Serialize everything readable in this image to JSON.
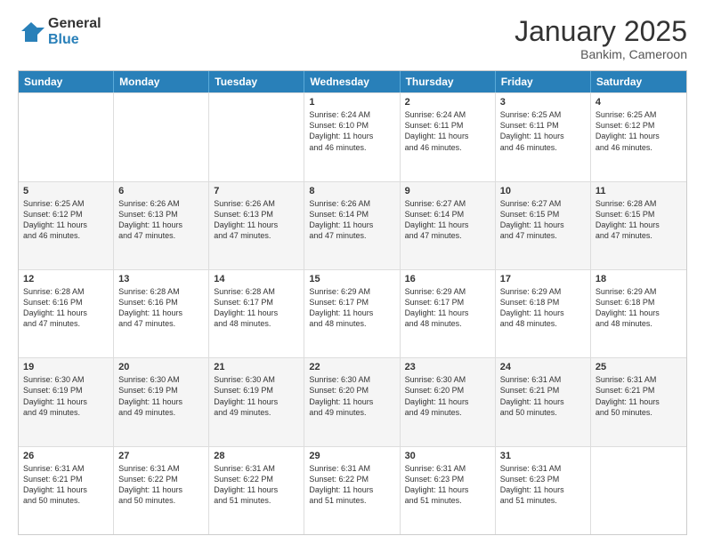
{
  "header": {
    "logo_general": "General",
    "logo_blue": "Blue",
    "month_title": "January 2025",
    "location": "Bankim, Cameroon"
  },
  "days_of_week": [
    "Sunday",
    "Monday",
    "Tuesday",
    "Wednesday",
    "Thursday",
    "Friday",
    "Saturday"
  ],
  "weeks": [
    [
      {
        "num": "",
        "lines": [],
        "empty": true
      },
      {
        "num": "",
        "lines": [],
        "empty": true
      },
      {
        "num": "",
        "lines": [],
        "empty": true
      },
      {
        "num": "1",
        "lines": [
          "Sunrise: 6:24 AM",
          "Sunset: 6:10 PM",
          "Daylight: 11 hours",
          "and 46 minutes."
        ]
      },
      {
        "num": "2",
        "lines": [
          "Sunrise: 6:24 AM",
          "Sunset: 6:11 PM",
          "Daylight: 11 hours",
          "and 46 minutes."
        ]
      },
      {
        "num": "3",
        "lines": [
          "Sunrise: 6:25 AM",
          "Sunset: 6:11 PM",
          "Daylight: 11 hours",
          "and 46 minutes."
        ]
      },
      {
        "num": "4",
        "lines": [
          "Sunrise: 6:25 AM",
          "Sunset: 6:12 PM",
          "Daylight: 11 hours",
          "and 46 minutes."
        ]
      }
    ],
    [
      {
        "num": "5",
        "lines": [
          "Sunrise: 6:25 AM",
          "Sunset: 6:12 PM",
          "Daylight: 11 hours",
          "and 46 minutes."
        ]
      },
      {
        "num": "6",
        "lines": [
          "Sunrise: 6:26 AM",
          "Sunset: 6:13 PM",
          "Daylight: 11 hours",
          "and 47 minutes."
        ]
      },
      {
        "num": "7",
        "lines": [
          "Sunrise: 6:26 AM",
          "Sunset: 6:13 PM",
          "Daylight: 11 hours",
          "and 47 minutes."
        ]
      },
      {
        "num": "8",
        "lines": [
          "Sunrise: 6:26 AM",
          "Sunset: 6:14 PM",
          "Daylight: 11 hours",
          "and 47 minutes."
        ]
      },
      {
        "num": "9",
        "lines": [
          "Sunrise: 6:27 AM",
          "Sunset: 6:14 PM",
          "Daylight: 11 hours",
          "and 47 minutes."
        ]
      },
      {
        "num": "10",
        "lines": [
          "Sunrise: 6:27 AM",
          "Sunset: 6:15 PM",
          "Daylight: 11 hours",
          "and 47 minutes."
        ]
      },
      {
        "num": "11",
        "lines": [
          "Sunrise: 6:28 AM",
          "Sunset: 6:15 PM",
          "Daylight: 11 hours",
          "and 47 minutes."
        ]
      }
    ],
    [
      {
        "num": "12",
        "lines": [
          "Sunrise: 6:28 AM",
          "Sunset: 6:16 PM",
          "Daylight: 11 hours",
          "and 47 minutes."
        ]
      },
      {
        "num": "13",
        "lines": [
          "Sunrise: 6:28 AM",
          "Sunset: 6:16 PM",
          "Daylight: 11 hours",
          "and 47 minutes."
        ]
      },
      {
        "num": "14",
        "lines": [
          "Sunrise: 6:28 AM",
          "Sunset: 6:17 PM",
          "Daylight: 11 hours",
          "and 48 minutes."
        ]
      },
      {
        "num": "15",
        "lines": [
          "Sunrise: 6:29 AM",
          "Sunset: 6:17 PM",
          "Daylight: 11 hours",
          "and 48 minutes."
        ]
      },
      {
        "num": "16",
        "lines": [
          "Sunrise: 6:29 AM",
          "Sunset: 6:17 PM",
          "Daylight: 11 hours",
          "and 48 minutes."
        ]
      },
      {
        "num": "17",
        "lines": [
          "Sunrise: 6:29 AM",
          "Sunset: 6:18 PM",
          "Daylight: 11 hours",
          "and 48 minutes."
        ]
      },
      {
        "num": "18",
        "lines": [
          "Sunrise: 6:29 AM",
          "Sunset: 6:18 PM",
          "Daylight: 11 hours",
          "and 48 minutes."
        ]
      }
    ],
    [
      {
        "num": "19",
        "lines": [
          "Sunrise: 6:30 AM",
          "Sunset: 6:19 PM",
          "Daylight: 11 hours",
          "and 49 minutes."
        ]
      },
      {
        "num": "20",
        "lines": [
          "Sunrise: 6:30 AM",
          "Sunset: 6:19 PM",
          "Daylight: 11 hours",
          "and 49 minutes."
        ]
      },
      {
        "num": "21",
        "lines": [
          "Sunrise: 6:30 AM",
          "Sunset: 6:19 PM",
          "Daylight: 11 hours",
          "and 49 minutes."
        ]
      },
      {
        "num": "22",
        "lines": [
          "Sunrise: 6:30 AM",
          "Sunset: 6:20 PM",
          "Daylight: 11 hours",
          "and 49 minutes."
        ]
      },
      {
        "num": "23",
        "lines": [
          "Sunrise: 6:30 AM",
          "Sunset: 6:20 PM",
          "Daylight: 11 hours",
          "and 49 minutes."
        ]
      },
      {
        "num": "24",
        "lines": [
          "Sunrise: 6:31 AM",
          "Sunset: 6:21 PM",
          "Daylight: 11 hours",
          "and 50 minutes."
        ]
      },
      {
        "num": "25",
        "lines": [
          "Sunrise: 6:31 AM",
          "Sunset: 6:21 PM",
          "Daylight: 11 hours",
          "and 50 minutes."
        ]
      }
    ],
    [
      {
        "num": "26",
        "lines": [
          "Sunrise: 6:31 AM",
          "Sunset: 6:21 PM",
          "Daylight: 11 hours",
          "and 50 minutes."
        ]
      },
      {
        "num": "27",
        "lines": [
          "Sunrise: 6:31 AM",
          "Sunset: 6:22 PM",
          "Daylight: 11 hours",
          "and 50 minutes."
        ]
      },
      {
        "num": "28",
        "lines": [
          "Sunrise: 6:31 AM",
          "Sunset: 6:22 PM",
          "Daylight: 11 hours",
          "and 51 minutes."
        ]
      },
      {
        "num": "29",
        "lines": [
          "Sunrise: 6:31 AM",
          "Sunset: 6:22 PM",
          "Daylight: 11 hours",
          "and 51 minutes."
        ]
      },
      {
        "num": "30",
        "lines": [
          "Sunrise: 6:31 AM",
          "Sunset: 6:23 PM",
          "Daylight: 11 hours",
          "and 51 minutes."
        ]
      },
      {
        "num": "31",
        "lines": [
          "Sunrise: 6:31 AM",
          "Sunset: 6:23 PM",
          "Daylight: 11 hours",
          "and 51 minutes."
        ]
      },
      {
        "num": "",
        "lines": [],
        "empty": true
      }
    ]
  ]
}
